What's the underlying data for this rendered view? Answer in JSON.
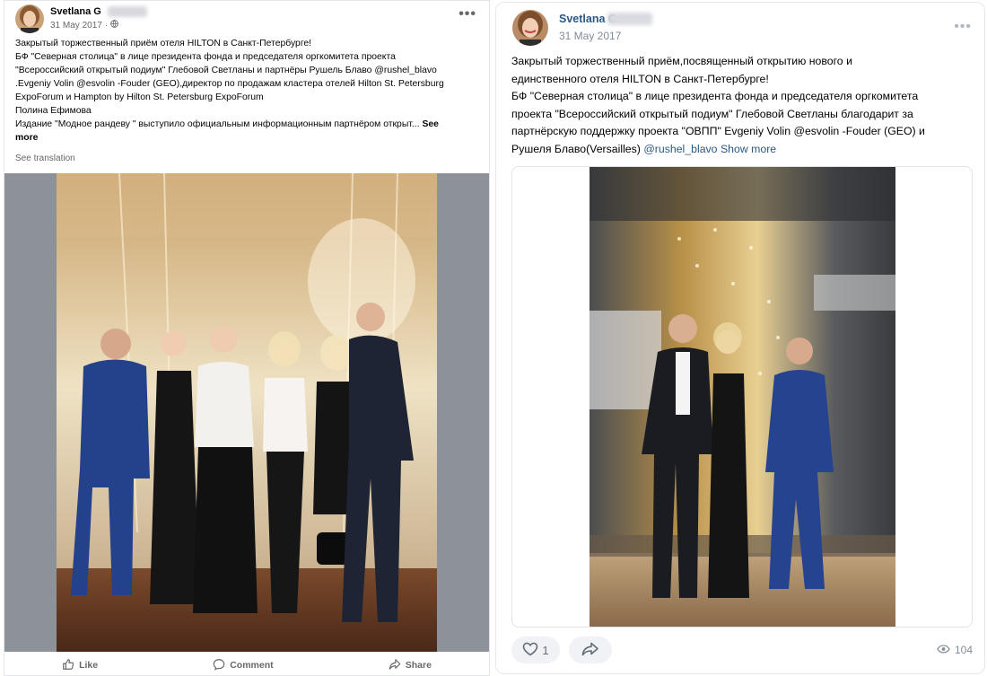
{
  "fb_post": {
    "author": "Svetlana G",
    "date": "31 May 2017",
    "audience_icon": "globe-icon",
    "more_icon": "•••",
    "text_lines": [
      "Закрытый торжественный приём отеля HILTON в Санкт-Петербурге!",
      "БФ \"Северная столица\" в лице президента фонда и председателя оргкомитета проекта",
      "\"Всероссийский открытый подиум\"  Глебовой Светланы  и партнёры Рушель Блаво @rushel_blavo",
      ".Evgeniy Volin @esvolin -Fouder (GEO),директор по продажам кластера отелей Hilton St. Petersburg",
      "ExpoForum и Hampton by Hilton St. Petersburg ExpoForum",
      "Полина Ефимова",
      "Издание \"Модное рандеву \" выступило официальным информационным партнёром открыт..."
    ],
    "see_more_part1": "See",
    "see_more_part2": "more",
    "see_translation": "See translation",
    "actions": {
      "like": "Like",
      "comment": "Comment",
      "share": "Share"
    }
  },
  "vk_post": {
    "author": "Svetlana G",
    "date": "31 May 2017",
    "more_icon": "•••",
    "text_lines": [
      "Закрытый торжественный приём,посвященный открытию нового и",
      "единственного отеля HILTON в Санкт-Петербурге!",
      "БФ \"Северная столица\" в лице президента фонда и председателя оргкомитета",
      "проекта \"Всероссийский открытый подиум\" Глебовой Светланы благодарит за",
      "партнёрскую поддержку проекта \"ОВПП\" Evgeniy Volin @esvolin -Fouder (GEO) и"
    ],
    "last_line_text": "Рушеля Блаво(Versailles) ",
    "last_line_link": "@rushel_blavo",
    "show_more": "Show more",
    "likes_count": "1",
    "views_count": "104"
  },
  "colors": {
    "vk_link": "#2a5885",
    "fb_secondary": "#65676b",
    "photo_frame": "#8d9198"
  }
}
